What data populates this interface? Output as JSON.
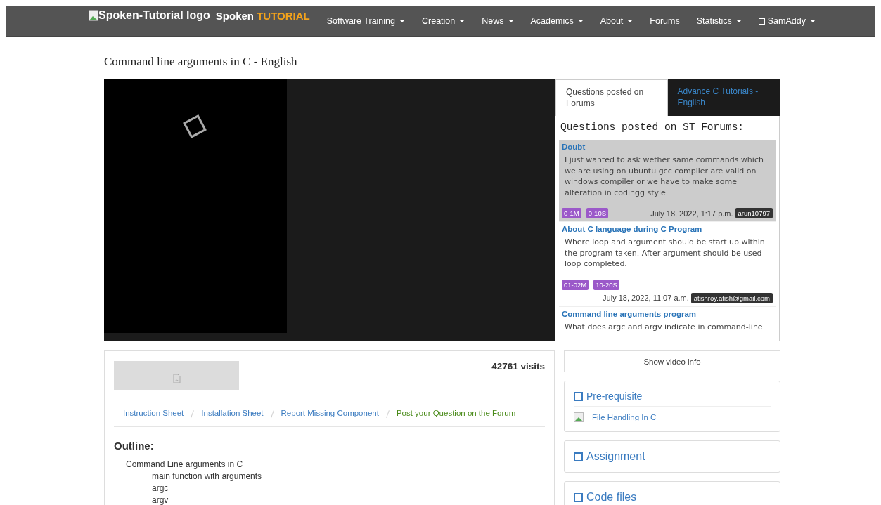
{
  "navbar": {
    "logo_alt": "Spoken-Tutorial logo",
    "brand": "Spoken",
    "brand_accent": "TUTORIAL",
    "items": [
      {
        "label": "Software Training",
        "dropdown": true
      },
      {
        "label": "Creation",
        "dropdown": true
      },
      {
        "label": "News",
        "dropdown": true
      },
      {
        "label": "Academics",
        "dropdown": true
      },
      {
        "label": "About",
        "dropdown": true
      },
      {
        "label": "Forums",
        "dropdown": false
      },
      {
        "label": "Statistics",
        "dropdown": true
      },
      {
        "label": "SamAddy",
        "dropdown": true,
        "kind": "user"
      }
    ]
  },
  "page_title": "Command line arguments in C - English",
  "side_tabs": [
    {
      "label": "Questions posted on Forums",
      "selected": true
    },
    {
      "label": "Advance C Tutorials - English",
      "selected": false
    }
  ],
  "forum": {
    "heading": "Questions posted on ST Forums:",
    "questions": [
      {
        "title": "Doubt",
        "body": "I just wanted to ask  wether same commands which we are using on ubuntu gcc compiler are valid on windows compiler or we have to make some alteration in codingg style",
        "tags": [
          "0-1M",
          "0-10S"
        ],
        "date": "July 18, 2022, 1:17 p.m.",
        "user": "arun10797",
        "highlighted": true
      },
      {
        "title": "About C language during C Program",
        "body": "Where loop and argument should be start up within the program taken. After argument should be used loop completed.",
        "tags": [
          "01-02M",
          "10-20S"
        ],
        "date": "July 18, 2022, 11:07 a.m.",
        "user": "atishroy.atish@gmail.com",
        "highlighted": false
      },
      {
        "title": "Command line arguments program",
        "body": "What does argc and argv indicate in command-line",
        "highlighted": false
      }
    ]
  },
  "visits": "42761 visits",
  "links": [
    {
      "label": "Instruction Sheet",
      "kind": "link"
    },
    {
      "label": "Installation Sheet",
      "kind": "link"
    },
    {
      "label": "Report Missing Component",
      "kind": "link"
    },
    {
      "label": "Post your Question on the Forum",
      "kind": "action"
    }
  ],
  "outline": {
    "heading": "Outline:",
    "items": [
      {
        "text": "Command Line arguments in C",
        "children": [
          {
            "text": "main function with arguments"
          },
          {
            "text": "argc"
          },
          {
            "text": "argv"
          }
        ]
      }
    ]
  },
  "show_info_button": "Show video info",
  "panels": [
    {
      "title": "Pre-requisite",
      "links": [
        "File Handling In C"
      ]
    },
    {
      "title": "Assignment"
    },
    {
      "title": "Code files"
    }
  ]
}
